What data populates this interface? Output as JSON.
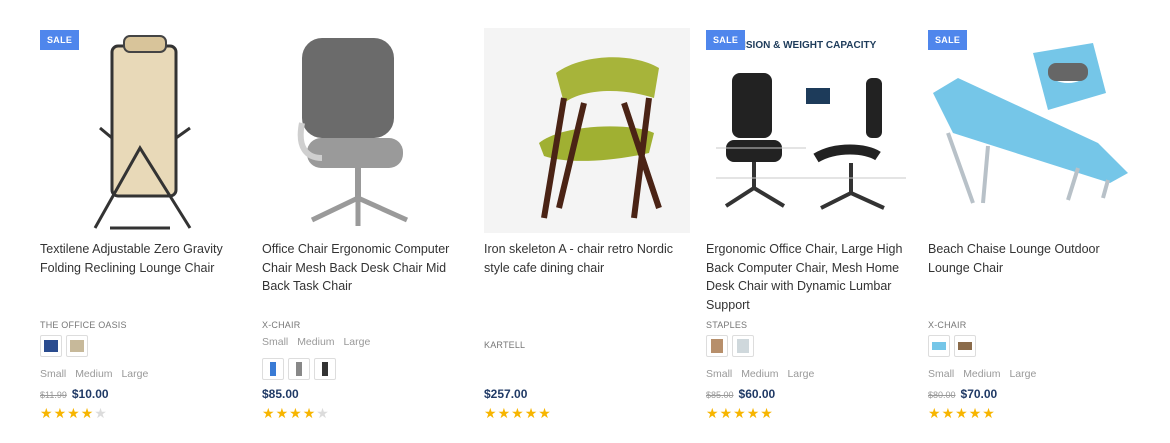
{
  "products": [
    {
      "title": "Textilene Adjustable Zero Gravity Folding Reclining Lounge Chair",
      "brand": "THE OFFICE OASIS",
      "sale_badge": "SALE",
      "sizes": [
        "Small",
        "Medium",
        "Large"
      ],
      "old_price": "$11.99",
      "price": "$10.00",
      "rating": 4
    },
    {
      "title": "Office Chair Ergonomic Computer Chair Mesh Back Desk Chair Mid Back Task Chair",
      "brand": "X-CHAIR",
      "sizes": [
        "Small",
        "Medium",
        "Large"
      ],
      "price": "$85.00",
      "rating": 4
    },
    {
      "title": "Iron skeleton A - chair retro Nordic style cafe dining chair",
      "brand": "KARTELL",
      "price": "$257.00",
      "rating": 5
    },
    {
      "title": "Ergonomic Office Chair, Large High Back Computer Chair, Mesh Home Desk Chair with Dynamic Lumbar Support",
      "brand": "STAPLES",
      "sale_badge": "SALE",
      "image_caption": "ENSION & WEIGHT CAPACITY",
      "sizes": [
        "Small",
        "Medium",
        "Large"
      ],
      "old_price": "$85.00",
      "price": "$60.00",
      "rating": 5
    },
    {
      "title": "Beach Chaise Lounge Outdoor Lounge Chair",
      "brand": "X-CHAIR",
      "sale_badge": "SALE",
      "sizes": [
        "Small",
        "Medium",
        "Large"
      ],
      "old_price": "$80.00",
      "price": "$70.00",
      "rating": 5
    }
  ],
  "icons": {
    "star": "★"
  },
  "colors": {
    "sale_badge": "#4f86ec",
    "price": "#203a66",
    "star_on": "#f7b500",
    "star_off": "#dcdcdc"
  }
}
